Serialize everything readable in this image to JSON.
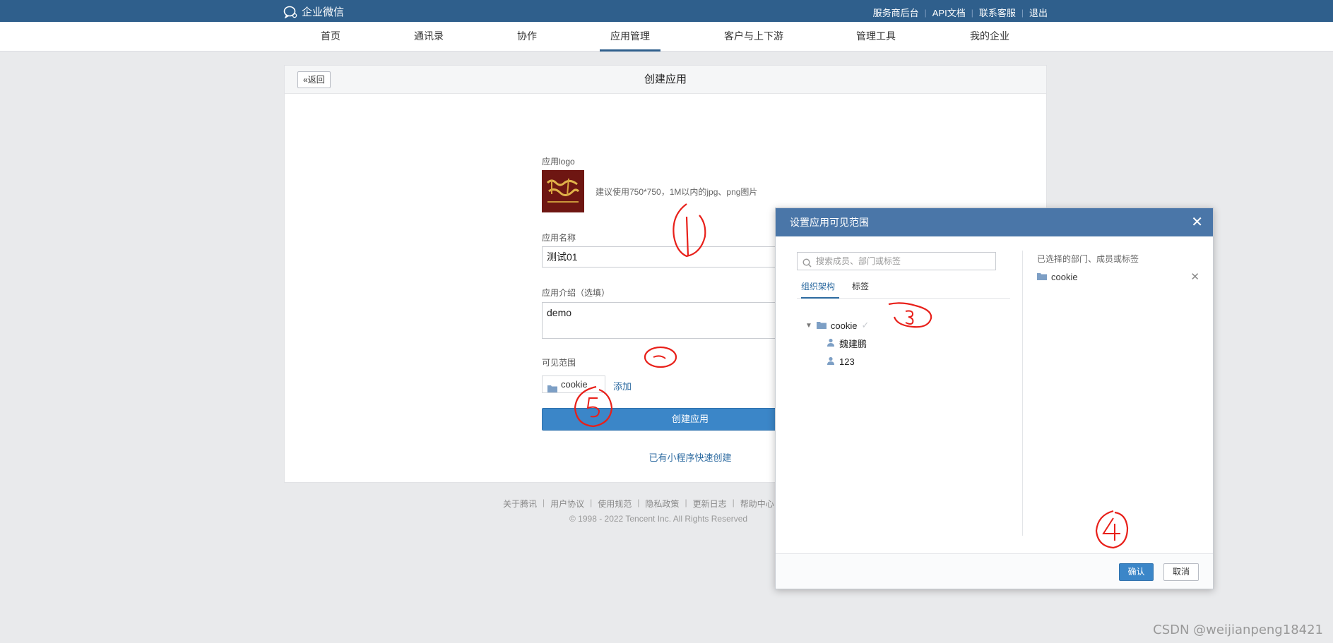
{
  "topbar": {
    "brand": "企业微信",
    "links": [
      "服务商后台",
      "API文档",
      "联系客服",
      "退出"
    ]
  },
  "nav": {
    "items": [
      "首页",
      "通讯录",
      "协作",
      "应用管理",
      "客户与上下游",
      "管理工具",
      "我的企业"
    ],
    "active": "应用管理"
  },
  "page": {
    "back_label": "返回",
    "title": "创建应用",
    "logo_label": "应用logo",
    "logo_hint": "建议使用750*750，1M以内的jpg、png图片",
    "name_label": "应用名称",
    "name_value": "测试01",
    "intro_label": "应用介绍（选填）",
    "intro_value": "demo",
    "scope_label": "可见范围",
    "scope_value": "cookie",
    "add_label": "添加",
    "create_label": "创建应用",
    "quick_create": "已有小程序快速创建"
  },
  "footer": {
    "links": [
      "关于腾讯",
      "用户协议",
      "使用规范",
      "隐私政策",
      "更新日志",
      "帮助中心"
    ],
    "copyright": "© 1998 - 2022 Tencent Inc. All Rights Reserved"
  },
  "modal": {
    "title": "设置应用可见范围",
    "search_placeholder": "搜索成员、部门或标签",
    "tabs": [
      "组织架构",
      "标签"
    ],
    "tree": {
      "root": "cookie",
      "members": [
        "魏建鹏",
        "123"
      ]
    },
    "selected_title": "已选择的部门、成员或标签",
    "selected": [
      "cookie"
    ],
    "ok_label": "确认",
    "cancel_label": "取消"
  },
  "annotations": [
    "1",
    "2",
    "3",
    "4",
    "5"
  ],
  "watermark": "CSDN @weijianpeng18421",
  "colors": {
    "topbar": "#2f5f8c",
    "accent": "#3b86c8",
    "modal_head": "#4a76a8",
    "annotation": "#e8201a"
  }
}
